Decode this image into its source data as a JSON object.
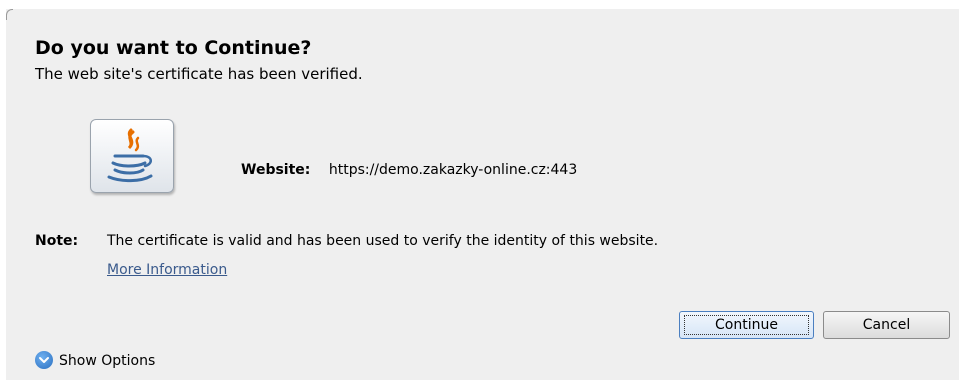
{
  "dialog": {
    "title": "Do you want to Continue?",
    "subtitle": "The web site's certificate has been verified.",
    "icon": "java-cup-icon"
  },
  "site": {
    "label": "Website:",
    "value": "https://demo.zakazky-online.cz:443"
  },
  "note": {
    "label": "Note:",
    "text": "The certificate is valid and has been used to verify the identity of this website.",
    "more_info_label": "More Information"
  },
  "buttons": {
    "continue_label": "Continue",
    "cancel_label": "Cancel"
  },
  "options": {
    "show_options_label": "Show Options",
    "icon": "chevron-down-icon"
  },
  "colors": {
    "dialog_background": "#efefef",
    "link": "#3a5a8c",
    "default_button_border": "#4b7fc0",
    "options_icon": "#2a6fc0"
  }
}
